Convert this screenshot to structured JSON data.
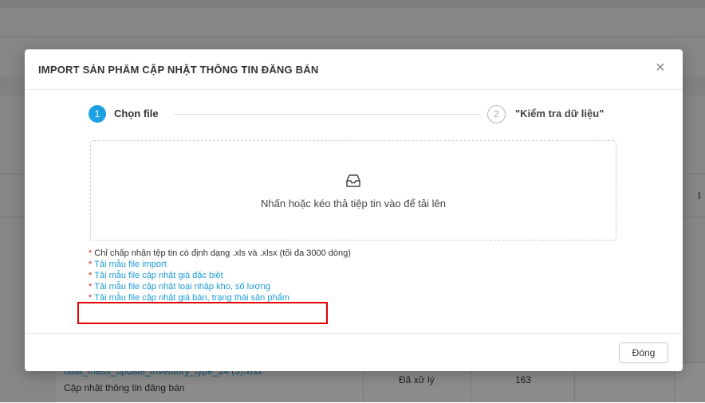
{
  "background": {
    "row_link": "data_mass_update_inventory_type_14 (3).xlsx",
    "row_name": "Cập nhật thông tin đăng bán",
    "row_status": "Đã xử lý",
    "row_count": "163",
    "right_edge_letter": "I"
  },
  "modal": {
    "title": "IMPORT SẢN PHẨM CẬP NHẬT THÔNG TIN ĐĂNG BÁN",
    "close_icon": "close-icon",
    "steps": [
      {
        "number": "1",
        "label": "Chọn file"
      },
      {
        "number": "2",
        "label": "\"Kiểm tra dữ liệu\""
      }
    ],
    "dropzone": {
      "icon": "inbox-icon",
      "text": "Nhấn hoặc kéo thả tiệp tin vào để tải lên"
    },
    "notes": [
      {
        "star": "*",
        "text": "Chỉ chấp nhận tệp tin có định dạng .xls và .xlsx (tối đa 3000 dòng)",
        "link": false
      },
      {
        "star": "*",
        "text": "Tải mẫu file import",
        "link": true
      },
      {
        "star": "*",
        "text": "Tải mẫu file cập nhật giá đặc biệt",
        "link": true
      },
      {
        "star": "*",
        "text": "Tải mẫu file cập nhật loại nhập kho, số lượng",
        "link": true
      },
      {
        "star": "*",
        "text": "Tải mẫu file cập nhật giá bán, trạng thái sản phẩm",
        "link": true
      }
    ],
    "footer": {
      "close_label": "Đóng"
    }
  },
  "colors": {
    "accent": "#1ba1e2",
    "link": "#1e9cd7",
    "required_star": "#e02020",
    "highlight_border": "#e00000"
  }
}
